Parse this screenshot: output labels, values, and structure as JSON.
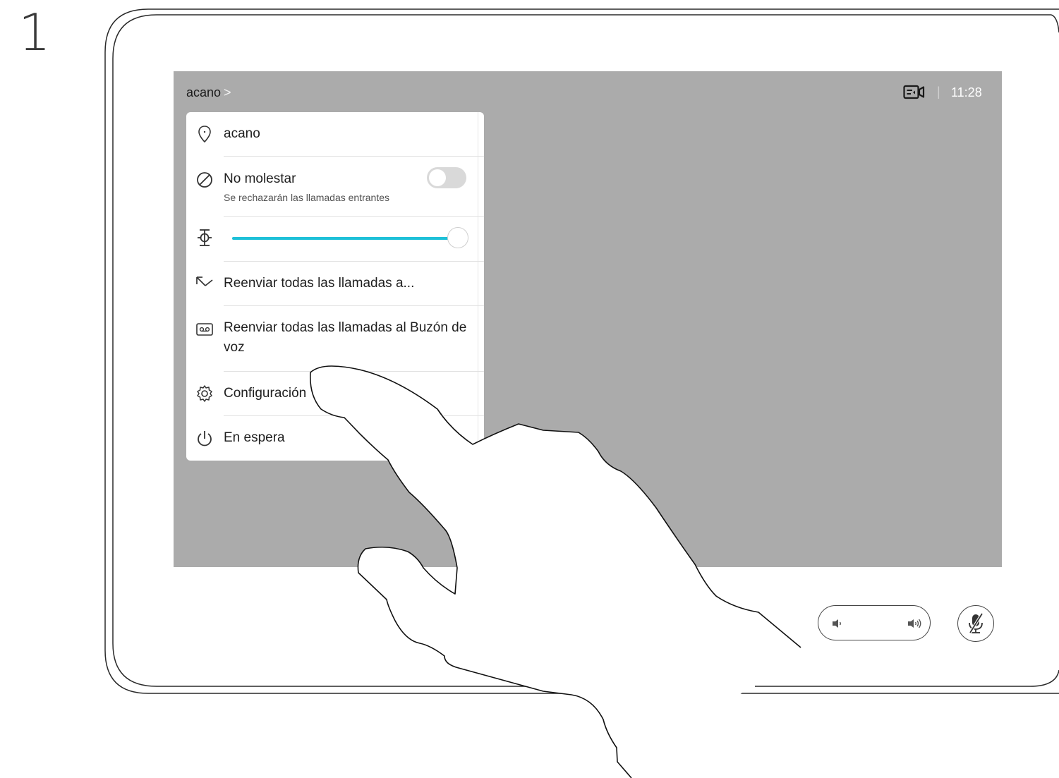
{
  "step": {
    "number": "1"
  },
  "screen": {
    "title": "acano",
    "title_chevron": ">",
    "status_separator": "|",
    "clock": "11:28",
    "background_color": "#ababab"
  },
  "menu": {
    "items": [
      {
        "icon": "location-pin-icon",
        "label": "acano"
      },
      {
        "icon": "do-not-disturb-icon",
        "label": "No molestar",
        "sublabel": "Se rechazarán las llamadas entrantes",
        "toggle_on": false
      },
      {
        "icon": "brightness-icon",
        "slider_value": 0.97,
        "slider_color": "#1ec0d8"
      },
      {
        "icon": "forward-call-icon",
        "label": "Reenviar todas las llamadas a..."
      },
      {
        "icon": "voicemail-icon",
        "label_line1": "Reenviar todas las llamadas al Buzón de",
        "label_line2": "voz"
      },
      {
        "icon": "gear-icon",
        "label": "Configuración"
      },
      {
        "icon": "power-icon",
        "label": "En espera"
      }
    ]
  },
  "controls": {
    "volume_icons": [
      "volume-down-icon",
      "volume-up-icon"
    ],
    "mute_icon": "microphone-muted-icon"
  }
}
